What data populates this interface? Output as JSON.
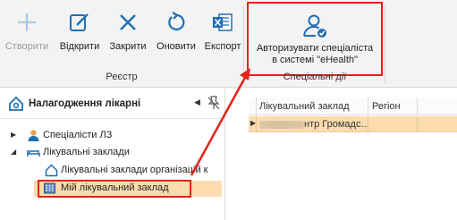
{
  "ribbon": {
    "buttons": {
      "create": "Створити",
      "open": "Відкрити",
      "close": "Закрити",
      "refresh": "Оновити",
      "export": "Експорт"
    },
    "groups": {
      "registry": "Реєстр",
      "special": "Спеціальні дії"
    },
    "special_button": {
      "line1": "Авторизувати спеціаліста",
      "line2": "в системі \"eHealth\""
    }
  },
  "tree": {
    "title": "Налагодження лікарні",
    "items": [
      {
        "label": "Спеціалісти ЛЗ"
      },
      {
        "label": "Лікувальні заклади"
      },
      {
        "label": "Лікувальні заклади організацій к"
      },
      {
        "label": "Мій лікувальний заклад"
      }
    ]
  },
  "grid": {
    "columns": [
      "Лікувальний заклад",
      "Регіон"
    ],
    "rows": [
      {
        "name": "нтр Громадс..."
      }
    ]
  },
  "colors": {
    "highlight_red": "#e2231a",
    "selection": "#fcdcae",
    "icon_blue": "#1f6fb5"
  }
}
